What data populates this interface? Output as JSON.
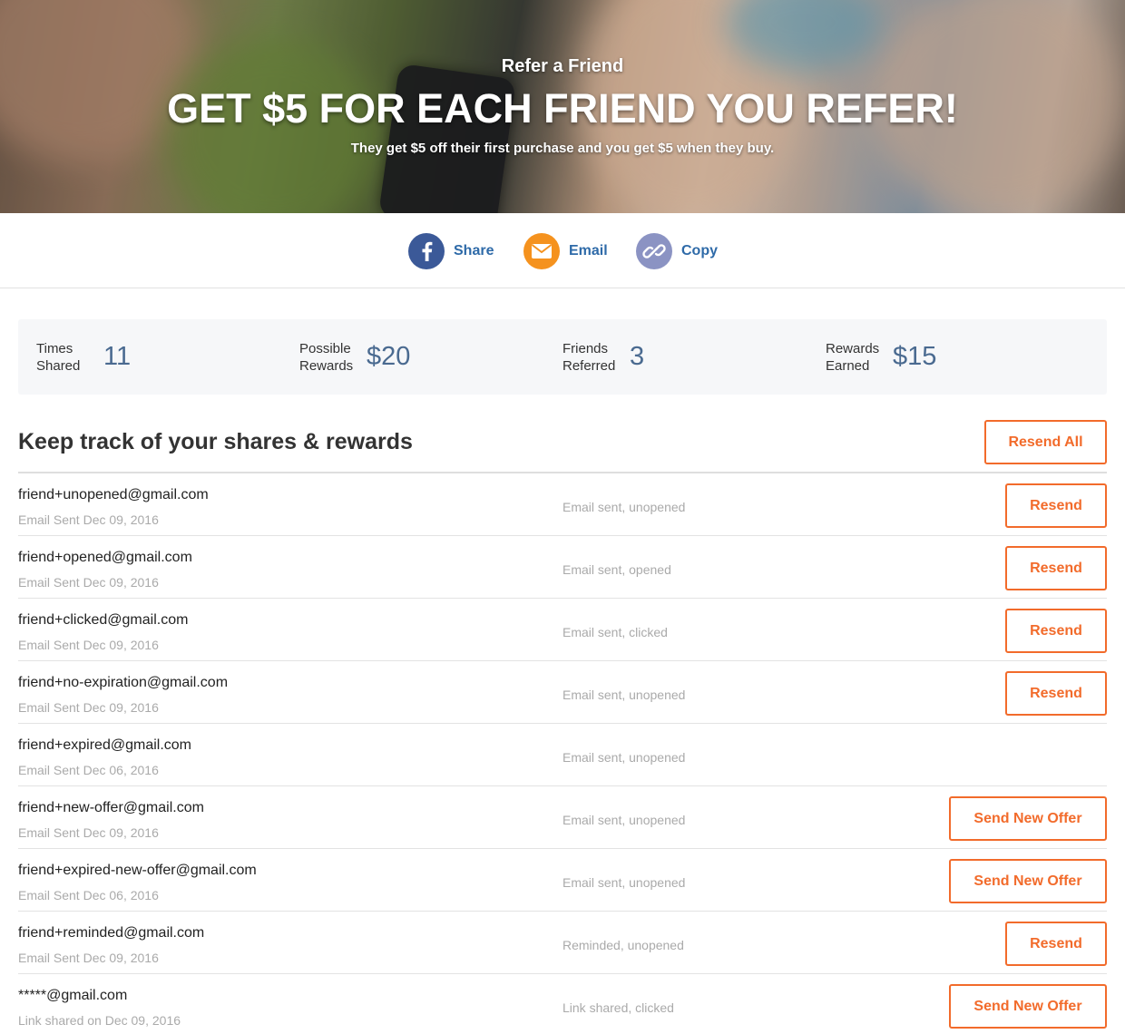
{
  "hero": {
    "kicker": "Refer a Friend",
    "headline": "GET $5 FOR EACH FRIEND YOU REFER!",
    "subtitle": "They get $5 off their first purchase and you get $5 when they buy."
  },
  "share": {
    "facebook_label": "Share",
    "email_label": "Email",
    "copy_label": "Copy"
  },
  "stats": [
    {
      "label": "Times Shared",
      "value": "11"
    },
    {
      "label": "Possible Rewards",
      "value": "$20"
    },
    {
      "label": "Friends Referred",
      "value": "3"
    },
    {
      "label": "Rewards Earned",
      "value": "$15"
    }
  ],
  "section": {
    "title": "Keep track of your shares & rewards",
    "resend_all_label": "Resend All"
  },
  "rows": [
    {
      "email": "friend+unopened@gmail.com",
      "date": "Email Sent Dec 09, 2016",
      "status": "Email sent, unopened",
      "action": "Resend"
    },
    {
      "email": "friend+opened@gmail.com",
      "date": "Email Sent Dec 09, 2016",
      "status": "Email sent, opened",
      "action": "Resend"
    },
    {
      "email": "friend+clicked@gmail.com",
      "date": "Email Sent Dec 09, 2016",
      "status": "Email sent, clicked",
      "action": "Resend"
    },
    {
      "email": "friend+no-expiration@gmail.com",
      "date": "Email Sent Dec 09, 2016",
      "status": "Email sent, unopened",
      "action": "Resend"
    },
    {
      "email": "friend+expired@gmail.com",
      "date": "Email Sent Dec 06, 2016",
      "status": "Email sent, unopened",
      "action": ""
    },
    {
      "email": "friend+new-offer@gmail.com",
      "date": "Email Sent Dec 09, 2016",
      "status": "Email sent, unopened",
      "action": "Send New Offer"
    },
    {
      "email": "friend+expired-new-offer@gmail.com",
      "date": "Email Sent Dec 06, 2016",
      "status": "Email sent, unopened",
      "action": "Send New Offer"
    },
    {
      "email": "friend+reminded@gmail.com",
      "date": "Email Sent Dec 09, 2016",
      "status": "Reminded, unopened",
      "action": "Resend"
    },
    {
      "email": "*****@gmail.com",
      "date": "Link shared on Dec 09, 2016",
      "status": "Link shared, clicked",
      "action": "Send New Offer"
    }
  ],
  "colors": {
    "accent": "#f26b2b",
    "link": "#2e6aa8",
    "stat_value": "#4a6a90",
    "facebook": "#3b5998",
    "email": "#f5921e",
    "copy": "#8b93c3"
  },
  "icons": {
    "facebook": "facebook-icon",
    "email": "envelope-icon",
    "copy": "link-icon"
  }
}
